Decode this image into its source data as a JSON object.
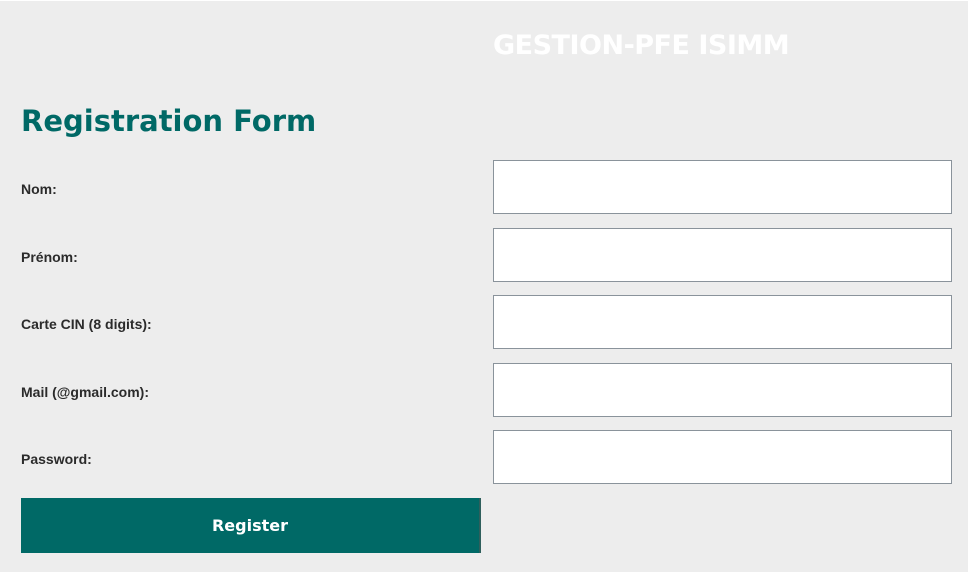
{
  "header": {
    "app_title": "GESTION-PFE ISIMM"
  },
  "form": {
    "title": "Registration Form",
    "fields": [
      {
        "label": "Nom:",
        "value": ""
      },
      {
        "label": "Prénom:",
        "value": ""
      },
      {
        "label": "Carte CIN (8 digits):",
        "value": ""
      },
      {
        "label": "Mail (@gmail.com):",
        "value": ""
      },
      {
        "label": "Password:",
        "value": ""
      }
    ],
    "submit_label": "Register"
  },
  "colors": {
    "background": "#ededed",
    "accent": "#006966",
    "input_border": "#8a939b",
    "label_text": "#2b2b2b"
  }
}
